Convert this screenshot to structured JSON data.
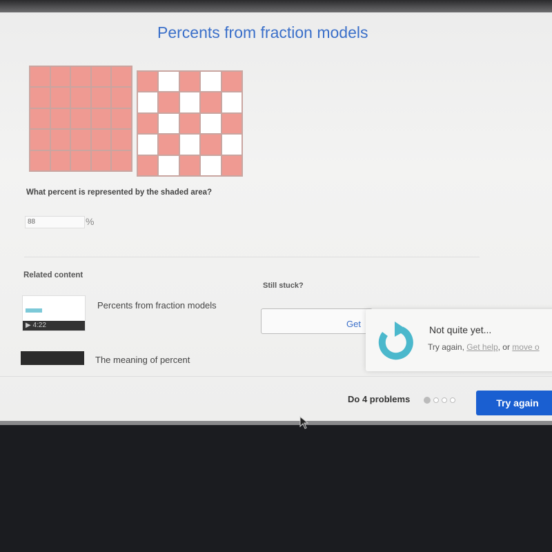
{
  "title": "Percents from fraction models",
  "models": [
    {
      "rows": 5,
      "cols": 5,
      "shaded": [
        [
          1,
          1,
          1,
          1,
          1
        ],
        [
          1,
          1,
          1,
          1,
          1
        ],
        [
          1,
          1,
          1,
          1,
          1
        ],
        [
          1,
          1,
          1,
          1,
          1
        ],
        [
          1,
          1,
          1,
          1,
          1
        ]
      ]
    },
    {
      "rows": 5,
      "cols": 5,
      "shaded": [
        [
          1,
          0,
          1,
          0,
          1
        ],
        [
          0,
          1,
          0,
          1,
          0
        ],
        [
          1,
          0,
          1,
          0,
          1
        ],
        [
          0,
          1,
          0,
          1,
          0
        ],
        [
          1,
          0,
          1,
          0,
          1
        ]
      ]
    }
  ],
  "colors": {
    "shaded": "#ef9a92",
    "accent": "#1a5fd1",
    "title": "#3a6fc9",
    "retry_icon": "#4bb8cc"
  },
  "question": "What percent is represented by the shaded area?",
  "answer": {
    "value": "88",
    "unit": "%"
  },
  "related": {
    "heading": "Related content",
    "items": [
      {
        "label": "Percents from fraction models",
        "duration": "▶ 4:22"
      },
      {
        "label": "The meaning of percent"
      }
    ]
  },
  "stuck": {
    "heading": "Still stuck?",
    "button": "Get"
  },
  "feedback": {
    "title": "Not quite yet...",
    "prefix": "Try again, ",
    "get_help": "Get help",
    "middle": ", or ",
    "move_on": "move o",
    "icon": "retry-icon"
  },
  "footer": {
    "progress_label": "Do 4 problems",
    "total": 4,
    "current": 1,
    "button": "Try again"
  }
}
